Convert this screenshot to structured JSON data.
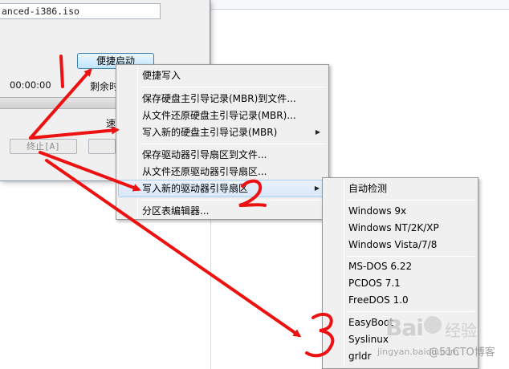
{
  "dialog": {
    "iso_path": "anced-i386.iso",
    "quick_start_label": "便捷启动",
    "elapsed_time": "00:00:00",
    "remaining_label": "剩余时间",
    "speed_label": "速",
    "stop_label": "终止[A]"
  },
  "main_menu": {
    "items": [
      {
        "label": "便捷写入"
      },
      {
        "label": "保存硬盘主引导记录(MBR)到文件..."
      },
      {
        "label": "从文件还原硬盘主引导记录(MBR)..."
      },
      {
        "label": "写入新的硬盘主引导记录(MBR)"
      },
      {
        "label": "保存驱动器引导扇区到文件..."
      },
      {
        "label": "从文件还原驱动器引导扇区..."
      },
      {
        "label": "写入新的驱动器引导扇区"
      },
      {
        "label": "分区表编辑器..."
      }
    ],
    "submenu_arrow": "▶"
  },
  "sub_menu": {
    "items": [
      {
        "label": "自动检测"
      },
      {
        "label": "Windows 9x"
      },
      {
        "label": "Windows NT/2K/XP"
      },
      {
        "label": "Windows Vista/7/8"
      },
      {
        "label": "MS-DOS 6.22"
      },
      {
        "label": "PCDOS 7.1"
      },
      {
        "label": "FreeDOS 1.0"
      },
      {
        "label": "EasyBoot"
      },
      {
        "label": "Syslinux"
      },
      {
        "label": "grldr"
      }
    ]
  },
  "annotations": {
    "step1": "1",
    "step2": "2",
    "step3": "3",
    "color": "#ee1111"
  },
  "watermark": {
    "logo": "Bai",
    "logo_suffix": "经验",
    "url": "jingyan.baidu.com",
    "blog": "@51CTO博客"
  }
}
